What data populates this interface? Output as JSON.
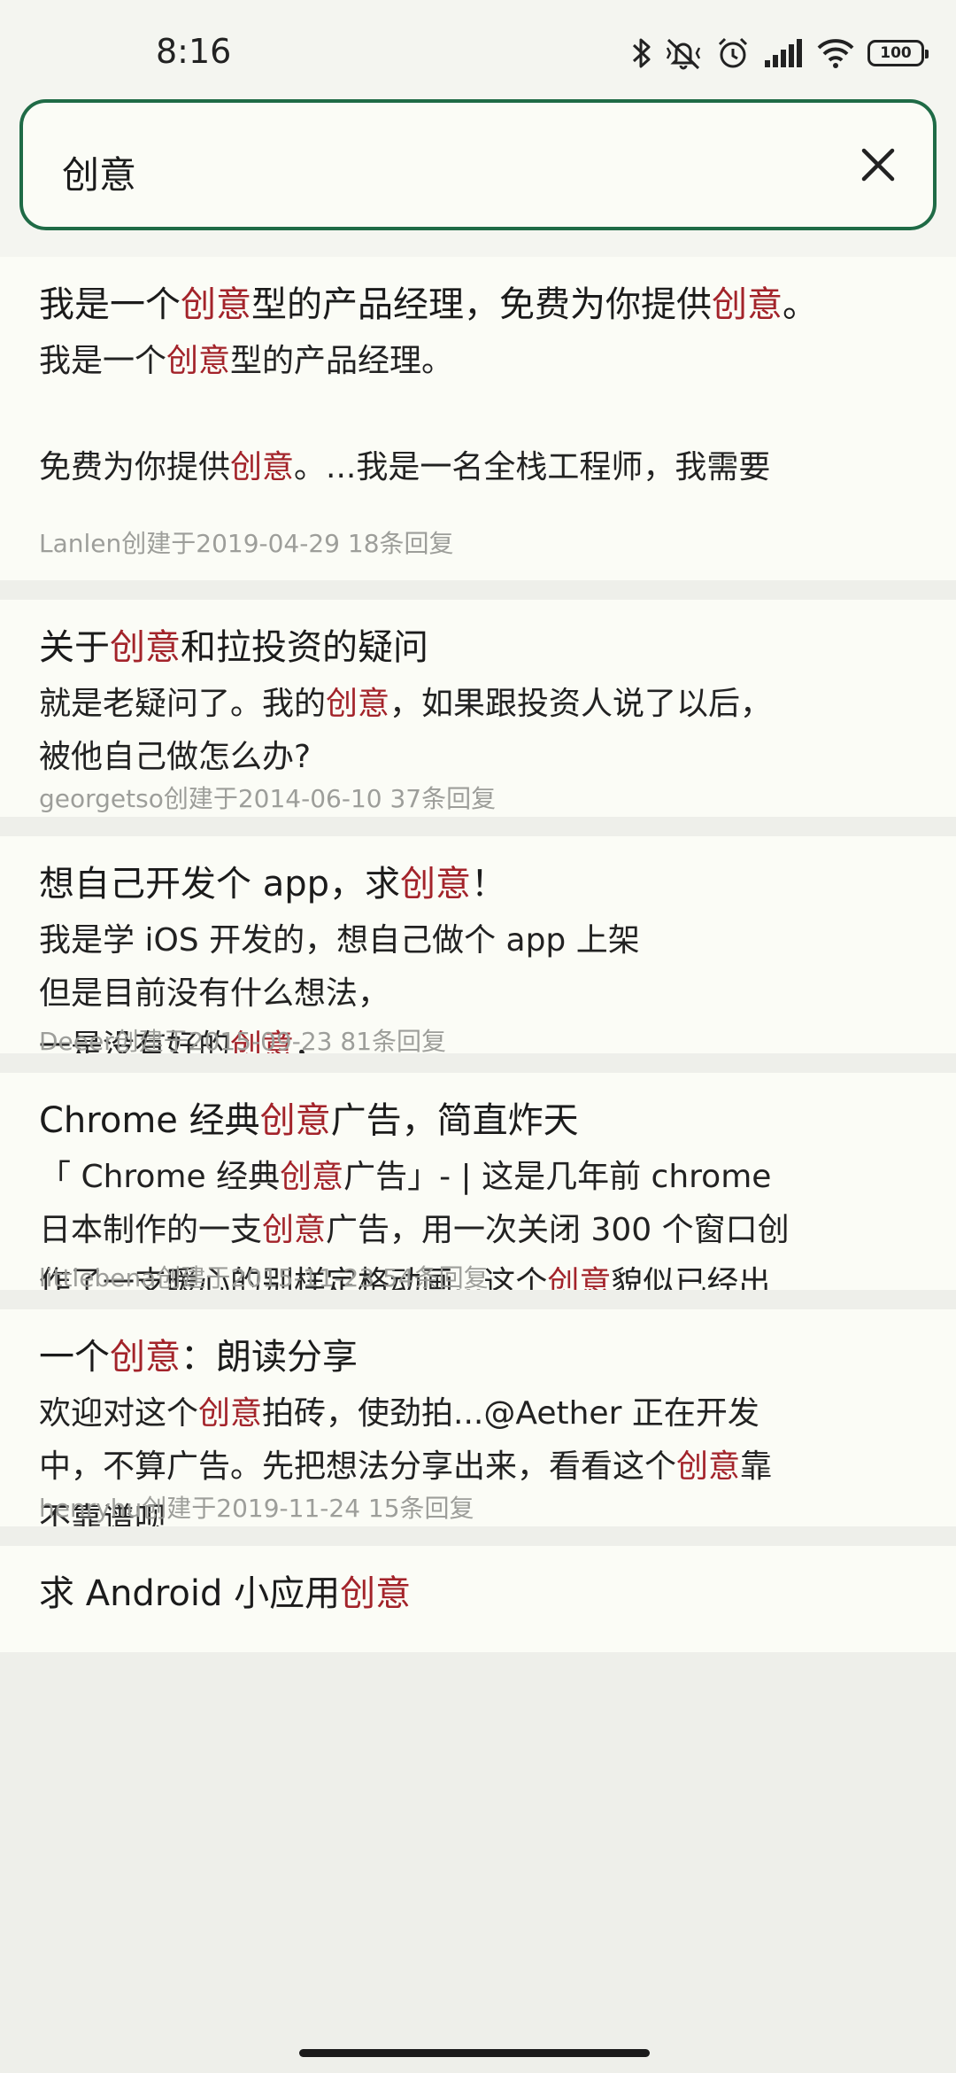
{
  "status_bar": {
    "time": "8:16",
    "battery": "100"
  },
  "search": {
    "query": "创意"
  },
  "highlight_color": "#a3232a",
  "results": [
    {
      "title": [
        "我是一个",
        "创意",
        "型的产品经理，免费为你提供",
        "创意",
        "。"
      ],
      "body": [
        "我是一个",
        "创意",
        "型的产品经理。\n\n免费为你提供",
        "创意",
        "。...我是一名全栈工程师，我需要"
      ],
      "meta": "Lanlen创建于2019-04-29 18条回复"
    },
    {
      "title": [
        "关于",
        "创意",
        "和拉投资的疑问"
      ],
      "body": [
        "就是老疑问了。我的",
        "创意",
        "，如果跟投资人说了以后，\n被他自己做怎么办?"
      ],
      "meta": "georgetso创建于2014-06-10 37条回复"
    },
    {
      "title": [
        "想自己开发个 app，求",
        "创意",
        "！"
      ],
      "body": [
        "我是学 iOS 开发的，想自己做个 app 上架\n但是目前没有什么想法，\n一是没有好的",
        "创意",
        "，"
      ],
      "meta": "Deeer创建于2015-09-23 81条回复"
    },
    {
      "title": [
        "Chrome 经典",
        "创意",
        "广告，简直炸天"
      ],
      "body": [
        "「 Chrome 经典",
        "创意",
        "广告」- | 这是几年前 chrome\n日本制作的一支",
        "创意",
        "广告，用一次关闭 300 个窗口创\n作了一支暖心的别样定格动画...这个",
        "创意",
        "貌似已经出"
      ],
      "meta": "littlebena创建于2015-11-23 54条回复"
    },
    {
      "title": [
        "一个",
        "创意",
        "：朗读分享"
      ],
      "body": [
        "欢迎对这个",
        "创意",
        "拍砖，使劲拍...@Aether 正在开发\n中，不算广告。先把想法分享出来，看看这个",
        "创意",
        "靠\n不靠谱呗"
      ],
      "meta": "henryhu创建于2019-11-24 15条回复"
    },
    {
      "title": [
        "求 Android 小应用",
        "创意"
      ],
      "body": [
        ""
      ],
      "meta": ""
    }
  ]
}
